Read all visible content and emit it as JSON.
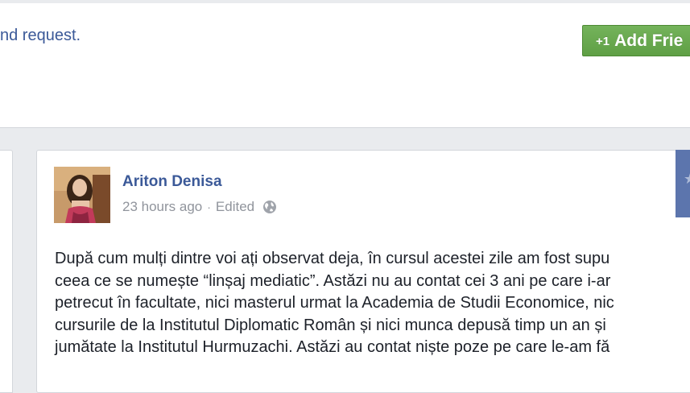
{
  "header": {
    "request_text": "nd request.",
    "add_friend_label": "Add Frie",
    "add_friend_icon": "+1"
  },
  "post": {
    "author": "Ariton Denisa",
    "timestamp": "23 hours ago",
    "separator": "·",
    "edited": "Edited",
    "privacy_icon": "globe-icon",
    "lines": [
      "După cum mulți dintre voi ați observat deja, în cursul acestei zile am fost supu",
      "ceea ce se numește “linșaj mediatic”. Astăzi nu au contat cei 3 ani pe care i-ar",
      "petrecut în facultate, nici masterul urmat la Academia de Studii Economice, nic",
      "cursurile de la Institutul Diplomatic Român și nici munca depusă timp un an și",
      "jumătate la Institutul Hurmuzachi. Astăzi au contat niște poze pe care le-am fă"
    ]
  },
  "colors": {
    "link_blue": "#3b5998",
    "button_green": "#69a74e",
    "page_bg": "#e9ebee",
    "meta_gray": "#90949c"
  }
}
